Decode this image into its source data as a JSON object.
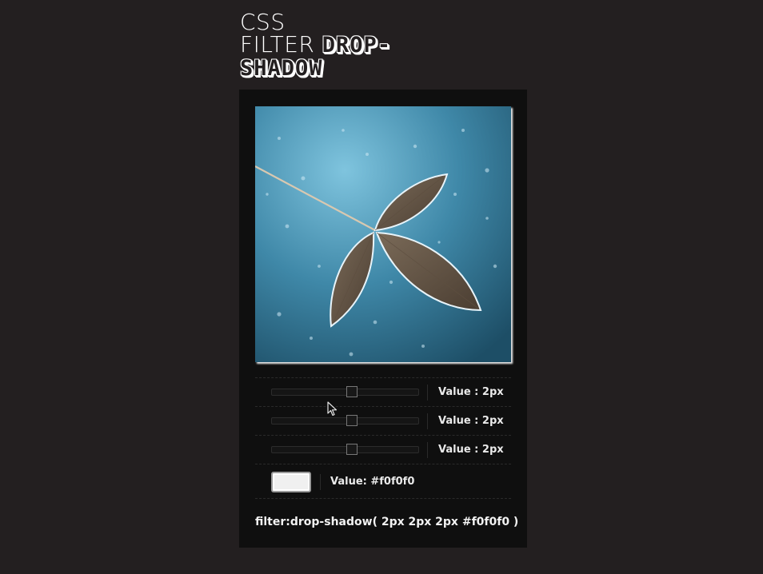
{
  "header": {
    "line1": "CSS",
    "line2": "FILTER",
    "highlight1": "DROP-",
    "highlight2": "SHADOW"
  },
  "controls": {
    "sliders": [
      {
        "label": "Value : 2px",
        "value": 2
      },
      {
        "label": "Value : 2px",
        "value": 2
      },
      {
        "label": "Value : 2px",
        "value": 2
      }
    ],
    "color": {
      "label": "Value: #f0f0f0",
      "value": "#f0f0f0"
    }
  },
  "output": {
    "css": "filter:drop-shadow( 2px 2px 2px #f0f0f0 )"
  },
  "colors": {
    "background": "#231f20",
    "panel": "#0f0f0f",
    "shadow": "#f0f0f0"
  }
}
